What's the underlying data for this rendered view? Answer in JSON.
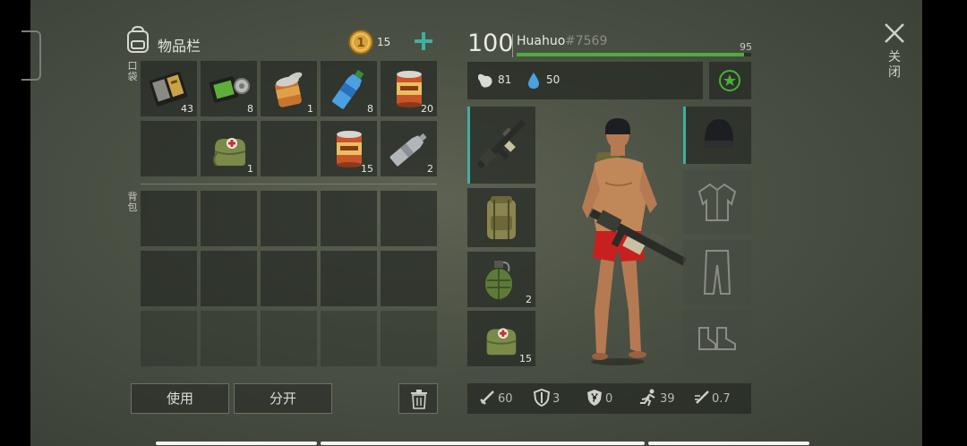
{
  "inventory": {
    "title": "物品栏",
    "coins": "15",
    "pockets_label": "口袋",
    "backpack_label": "背包",
    "pockets": [
      {
        "icon": "notebook-icon",
        "qty": "43"
      },
      {
        "icon": "pda-icon",
        "qty": "8"
      },
      {
        "icon": "open-can-icon",
        "qty": "1"
      },
      {
        "icon": "water-bottle-icon",
        "qty": "8"
      },
      {
        "icon": "food-can-icon",
        "qty": "20"
      },
      {
        "icon": "",
        "qty": ""
      },
      {
        "icon": "medkit-bag-icon",
        "qty": "1"
      },
      {
        "icon": "",
        "qty": ""
      },
      {
        "icon": "food-can-icon",
        "qty": "15"
      },
      {
        "icon": "empty-bottle-icon",
        "qty": "2"
      }
    ],
    "use_button": "使用",
    "split_button": "分开"
  },
  "player": {
    "health": "100",
    "name": "Huahuo",
    "tag": "#7569",
    "level_value": "95",
    "hunger": "81",
    "thirst": "50",
    "health_fraction": 0.97
  },
  "equipment": {
    "weapon_slots": [
      {
        "icon": "rifle-icon",
        "qty": ""
      },
      {
        "icon": "backpack-icon",
        "qty": ""
      },
      {
        "icon": "grenade-icon",
        "qty": "2"
      },
      {
        "icon": "medkit-bag-icon",
        "qty": "15"
      }
    ],
    "armor_slots": [
      {
        "icon": "beanie-icon"
      },
      {
        "icon": "jacket-icon"
      },
      {
        "icon": "pants-icon"
      },
      {
        "icon": "boots-icon"
      }
    ]
  },
  "stats": {
    "attack": "60",
    "defense": "3",
    "radiation": "0",
    "speed": "39",
    "attack_speed": "0.7"
  },
  "close_label": "关闭",
  "colors": {
    "accent_teal": "#3fb0a0",
    "health_green": "#4cae3a",
    "coin_gold": "#d8a23a"
  }
}
